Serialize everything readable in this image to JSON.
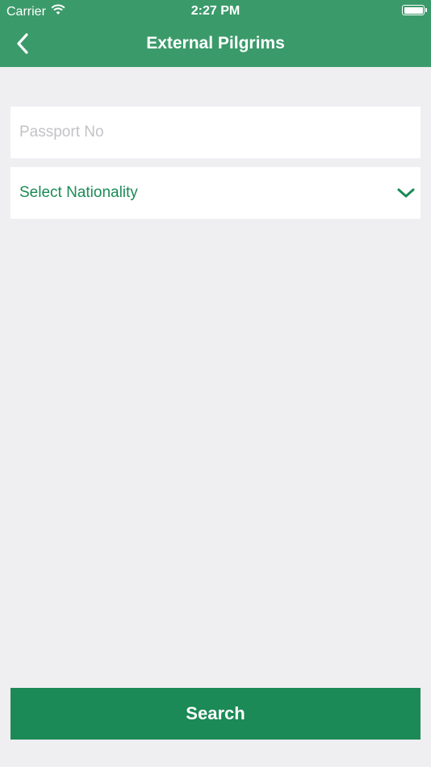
{
  "status_bar": {
    "carrier": "Carrier",
    "time": "2:27 PM",
    "wifi_icon": "wifi-icon",
    "battery_icon": "battery-icon"
  },
  "nav": {
    "back_icon": "chevron-left-icon",
    "title": "External Pilgrims"
  },
  "form": {
    "passport": {
      "placeholder": "Passport No",
      "value": ""
    },
    "nationality": {
      "label": "Select Nationality",
      "icon": "chevron-down-icon"
    },
    "search_label": "Search"
  },
  "colors": {
    "header": "#3b9a6a",
    "accent": "#1b8a56",
    "background": "#efeef1",
    "placeholder": "#c3c3c7"
  }
}
